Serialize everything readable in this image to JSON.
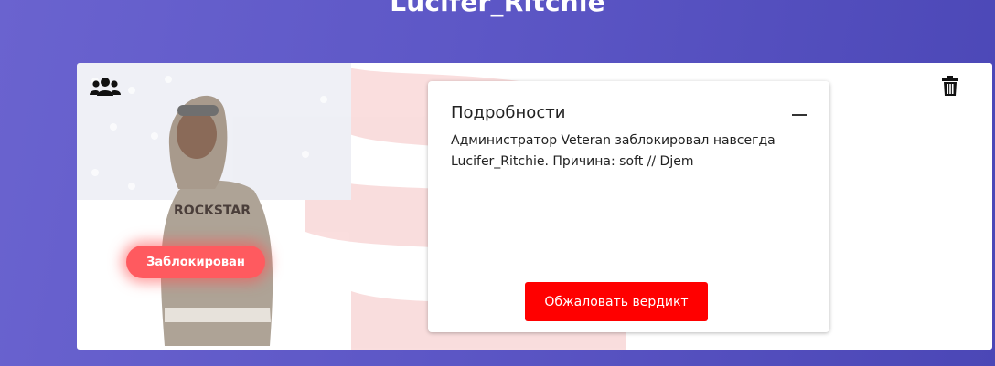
{
  "header": {
    "title": "Lucifer_Ritchie"
  },
  "profile": {
    "status_badge": "Заблокирован",
    "icons": {
      "group": "users-group-icon",
      "delete": "trash-icon"
    }
  },
  "details": {
    "title": "Подробности",
    "collapse_icon": "minus-icon",
    "text": "Администратор Veteran заблокировал навсегда Lucifer_Ritchie. Причина: soft // Djem",
    "appeal_button": "Обжаловать вердикт"
  },
  "colors": {
    "badge": "#ff5a5f",
    "appeal_button": "#ff0000",
    "background_start": "#6a63cf",
    "background_end": "#4b47b6"
  }
}
